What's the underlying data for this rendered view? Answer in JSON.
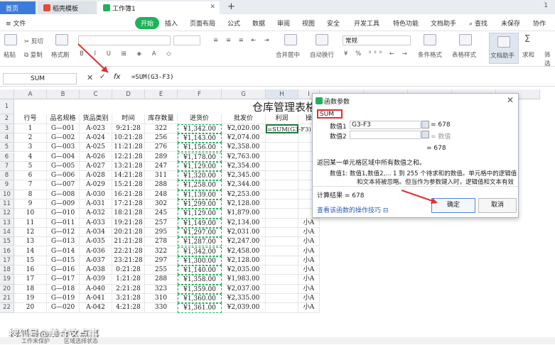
{
  "tabs": {
    "home": "首页",
    "template": "稻壳模板",
    "workbook": "工作簿1",
    "page_num": "1"
  },
  "menus": [
    "文件",
    "开始",
    "插入",
    "页面布局",
    "公式",
    "数据",
    "审阅",
    "视图",
    "安全",
    "开发工具",
    "特色功能",
    "文档助手",
    "查找",
    "未保存",
    "协作"
  ],
  "ribbon": {
    "paste": "粘贴",
    "cut": "剪切",
    "copy": "复制",
    "format_painter": "格式刷",
    "merge": "合并居中",
    "wrap": "自动换行",
    "number_format": "常规",
    "cond_format": "条件格式",
    "table_style": "表格样式",
    "doc_assist": "文档助手",
    "sum": "求和",
    "filter": "筛选"
  },
  "formula_bar": {
    "name_box": "SUM",
    "fx": "fx",
    "formula": "=SUM(G3-F3)"
  },
  "sheet": {
    "title": "仓库管理表格",
    "columns": [
      "A",
      "B",
      "C",
      "D",
      "E",
      "F",
      "G",
      "H",
      "I"
    ],
    "headers": [
      "行号",
      "品名规格",
      "货品类别",
      "时间",
      "库存数量",
      "进货价",
      "批发价",
      "利润",
      "操"
    ],
    "rows": [
      [
        "1",
        "G—001",
        "A-023",
        "9:21:28",
        "322",
        "¥1,342.00",
        "¥2,020.00",
        "=SUM(G3-F3)",
        ""
      ],
      [
        "2",
        "G—002",
        "A-024",
        "10:21:28",
        "256",
        "¥1,143.00",
        "¥2,074.00",
        "",
        ""
      ],
      [
        "3",
        "G—003",
        "A-025",
        "11:21:28",
        "276",
        "¥1,156.00",
        "¥2,358.00",
        "",
        ""
      ],
      [
        "4",
        "G—004",
        "A-026",
        "12:21:28",
        "289",
        "¥1,178.00",
        "¥2,763.00",
        "",
        ""
      ],
      [
        "5",
        "G—005",
        "A-027",
        "13:21:28",
        "247",
        "¥1,129.00",
        "¥2,354.00",
        "",
        ""
      ],
      [
        "6",
        "G—006",
        "A-028",
        "14:21:28",
        "311",
        "¥1,320.00",
        "¥2,345.00",
        "",
        ""
      ],
      [
        "7",
        "G—007",
        "A-029",
        "15:21:28",
        "288",
        "¥1,258.00",
        "¥2,344.00",
        "",
        ""
      ],
      [
        "8",
        "G—008",
        "A-030",
        "16:21:28",
        "248",
        "¥1,139.00",
        "¥2,253.00",
        "",
        ""
      ],
      [
        "9",
        "G—009",
        "A-031",
        "17:21:28",
        "302",
        "¥1,299.00",
        "¥2,128.00",
        "",
        ""
      ],
      [
        "10",
        "G—010",
        "A-032",
        "18:21:28",
        "245",
        "¥1,129.00",
        "¥1,879.00",
        "",
        ""
      ],
      [
        "11",
        "G—011",
        "A-033",
        "19:21:28",
        "257",
        "¥1,149.00",
        "¥2,134.00",
        "",
        "小A"
      ],
      [
        "12",
        "G—012",
        "A-034",
        "20:21:28",
        "295",
        "¥1,297.00",
        "¥2,031.00",
        "",
        "小A"
      ],
      [
        "13",
        "G—013",
        "A-035",
        "21:21:28",
        "278",
        "¥1,287.00",
        "¥2,247.00",
        "",
        "小A"
      ],
      [
        "14",
        "G—014",
        "A-036",
        "22:21:28",
        "322",
        "¥1,342.00",
        "¥2,458.00",
        "",
        "小A"
      ],
      [
        "15",
        "G—015",
        "A-037",
        "23:21:28",
        "297",
        "¥1,300.00",
        "¥2,128.00",
        "",
        "小A"
      ],
      [
        "16",
        "G—016",
        "A-038",
        "0:21:28",
        "255",
        "¥1,140.00",
        "¥2,035.00",
        "",
        "小A"
      ],
      [
        "17",
        "G—017",
        "A-039",
        "1:21:28",
        "288",
        "¥1,358.00",
        "¥1,983.00",
        "",
        "小A"
      ],
      [
        "18",
        "G—018",
        "A-040",
        "2:21:28",
        "323",
        "¥1,359.00",
        "¥2,037.00",
        "",
        "小A"
      ],
      [
        "19",
        "G—019",
        "A-041",
        "3:21:28",
        "310",
        "¥1,360.00",
        "¥2,335.00",
        "",
        "小A"
      ],
      [
        "20",
        "G—020",
        "A-042",
        "4:21:28",
        "330",
        "¥1,361.00",
        "¥2,039.00",
        "",
        "小A"
      ]
    ]
  },
  "dialog": {
    "title": "函数参数",
    "function_name": "SUM",
    "arg1_label": "数值1",
    "arg1_value": "G3-F3",
    "arg1_result": "= 678",
    "arg2_label": "数值2",
    "arg2_hint": "= 数值",
    "total": "= 678",
    "desc": "返回某一单元格区域中所有数值之和。",
    "param_desc_1": "数值1:  数值1,数值2,... 1 到 255 个待求和的数值。单元格中的逻辑值",
    "param_desc_2": "和文本将被忽略。但当作为参数键入时，逻辑值和文本有效",
    "result": "计算结果 = 678",
    "help_link": "查看该函数的操作技巧",
    "ok": "确定",
    "cancel": "取消"
  },
  "status": {
    "protect": "工作未保护",
    "mode": "区域选择状态"
  },
  "watermark": "搜狐号@美食这点事",
  "colors": {
    "accent": "#1fb25a",
    "highlight": "#e0302c",
    "primary_blue": "#3d7bd9"
  }
}
